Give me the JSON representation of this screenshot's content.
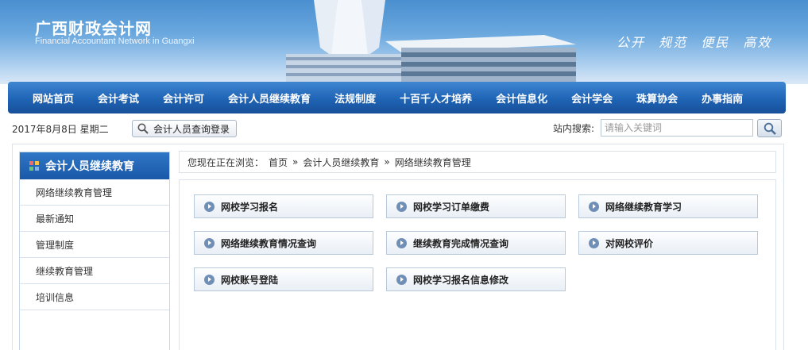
{
  "header": {
    "title": "广西财政会计网",
    "subtitle": "Financial Accountant Network in Guangxi",
    "slogans": [
      "公开",
      "规范",
      "便民",
      "高效"
    ]
  },
  "nav": {
    "items": [
      "网站首页",
      "会计考试",
      "会计许可",
      "会计人员继续教育",
      "法规制度",
      "十百千人才培养",
      "会计信息化",
      "会计学会",
      "珠算协会",
      "办事指南"
    ]
  },
  "toolbar": {
    "date": "2017年8月8日  星期二",
    "query_button": "会计人员查询登录",
    "search_label": "站内搜索:",
    "search_placeholder": "请输入关键词"
  },
  "sidebar": {
    "title": "会计人员继续教育",
    "items": [
      "网络继续教育管理",
      "最新通知",
      "管理制度",
      "继续教育管理",
      "培训信息"
    ]
  },
  "breadcrumb": {
    "prefix": "您现在正在浏览：",
    "home": "首页",
    "sep": "»",
    "level1": "会计人员继续教育",
    "level2": "网络继续教育管理"
  },
  "links": [
    "网校学习报名",
    "网校学习订单缴费",
    "网络继续教育学习",
    "网络继续教育情况查询",
    "继续教育完成情况查询",
    "对网校评价",
    "网校账号登陆",
    "网校学习报名信息修改"
  ],
  "colors": {
    "nav_blue": "#1f64b5",
    "sidebar_head": "#1a58a8",
    "bullet": "#6f8fb6"
  }
}
